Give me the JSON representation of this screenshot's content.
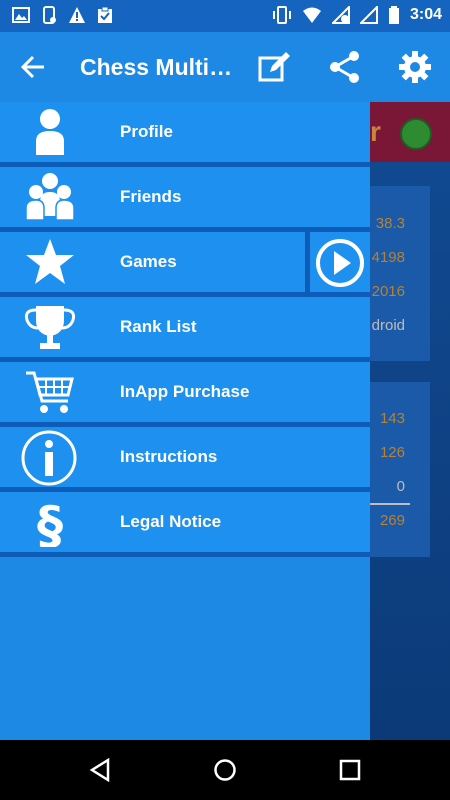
{
  "status_bar": {
    "time": "3:04",
    "left_icons": [
      "image-icon",
      "phone-icon",
      "warning-icon",
      "clipboard-icon"
    ],
    "right_icons": [
      "vibrate-icon",
      "wifi-icon",
      "no-sim-icon",
      "signal-icon",
      "battery-icon"
    ]
  },
  "app_bar": {
    "title": "Chess Multi…",
    "icons": [
      "back-arrow-icon",
      "edit-icon",
      "share-icon",
      "settings-icon"
    ]
  },
  "drawer": {
    "items": [
      {
        "label": "Profile",
        "icon": "person-icon"
      },
      {
        "label": "Friends",
        "icon": "people-icon"
      },
      {
        "label": "Games",
        "icon": "star-icon",
        "extra_icon": "play-icon"
      },
      {
        "label": "Rank List",
        "icon": "trophy-icon"
      },
      {
        "label": "InApp Purchase",
        "icon": "cart-icon"
      },
      {
        "label": "Instructions",
        "icon": "info-icon"
      },
      {
        "label": "Legal Notice",
        "icon": "section-icon"
      }
    ]
  },
  "background": {
    "header_letter": "r",
    "card1_values": [
      "38.3",
      "4198",
      "2016",
      "droid"
    ],
    "card2_values": [
      "143",
      "126",
      "0",
      "269"
    ]
  },
  "colors": {
    "status_bar": "#1565c0",
    "app_bar": "#1e88e5",
    "drawer_item": "#1e90f0",
    "divider": "#0d5cb8"
  }
}
